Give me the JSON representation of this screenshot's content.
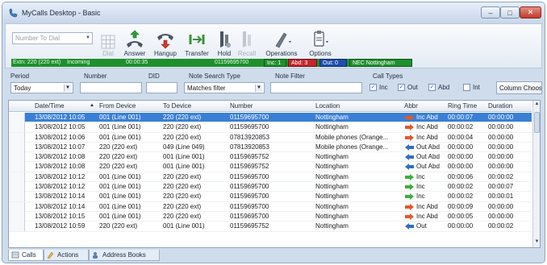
{
  "window": {
    "title": "MyCalls Desktop - Basic"
  },
  "toolbar": {
    "dial_placeholder": "Number To Dial",
    "buttons": {
      "dial": "Dial",
      "answer": "Answer",
      "hangup": "Hangup",
      "transfer": "Transfer",
      "hold": "Hold",
      "recall": "Recall",
      "operations": "Operations",
      "options": "Options"
    },
    "status": {
      "extn": "Extn: 220 (220 ext)",
      "state": "Incoming",
      "timer": "00:00:35",
      "number": "01159695700"
    },
    "counters": {
      "inc": "Inc: 1",
      "abd": "Abd: 3",
      "out": "Out: 0",
      "site": "NEC Nottingham"
    },
    "colors": {
      "green": "#1f8f2e",
      "red": "#c1272d",
      "blue": "#1f4fa8"
    }
  },
  "filters": {
    "period_label": "Period",
    "period_value": "Today",
    "number_label": "Number",
    "did_label": "DID",
    "note_search_type_label": "Note Search Type",
    "note_search_type_value": "Matches filter",
    "note_filter_label": "Note Filter",
    "call_types_label": "Call Types",
    "call_types": {
      "inc": "Inc",
      "out": "Out",
      "abd": "Abd",
      "int": "Int"
    },
    "column_chooser": "Column Chooser"
  },
  "grid": {
    "columns": [
      "Date/Time",
      "From Device",
      "To Device",
      "Number",
      "Location",
      "Abbr",
      "Ring Time",
      "Duration"
    ],
    "rows": [
      [
        "13/08/2012 10:05",
        "001 (Line 001)",
        "220 (220 ext)",
        "01159695700",
        "Nottingham",
        "Inc Abd",
        "00:00:07",
        "00:00:00"
      ],
      [
        "13/08/2012 10:05",
        "001 (Line 001)",
        "220 (220 ext)",
        "01159695700",
        "Nottingham",
        "Inc Abd",
        "00:00:02",
        "00:00:00"
      ],
      [
        "13/08/2012 10:06",
        "001 (Line 001)",
        "220 (220 ext)",
        "07813920853",
        "Mobile phones (Orange...",
        "Inc Abd",
        "00:00:04",
        "00:00:00"
      ],
      [
        "13/08/2012 10:07",
        "220 (220 ext)",
        "049 (Line 049)",
        "07813920853",
        "Mobile phones (Orange...",
        "Out Abd",
        "00:00:00",
        "00:00:00"
      ],
      [
        "13/08/2012 10:08",
        "220 (220 ext)",
        "001 (Line 001)",
        "01159695752",
        "Nottingham",
        "Out Abd",
        "00:00:00",
        "00:00:00"
      ],
      [
        "13/08/2012 10:08",
        "220 (220 ext)",
        "001 (Line 001)",
        "01159695752",
        "Nottingham",
        "Out Abd",
        "00:00:00",
        "00:00:00"
      ],
      [
        "13/08/2012 10:12",
        "001 (Line 001)",
        "220 (220 ext)",
        "01159695700",
        "Nottingham",
        "Inc",
        "00:00:06",
        "00:00:02"
      ],
      [
        "13/08/2012 10:12",
        "001 (Line 001)",
        "220 (220 ext)",
        "01159695700",
        "Nottingham",
        "Inc",
        "00:00:02",
        "00:00:07"
      ],
      [
        "13/08/2012 10:14",
        "001 (Line 001)",
        "220 (220 ext)",
        "01159695700",
        "Nottingham",
        "Inc",
        "00:00:02",
        "00:00:01"
      ],
      [
        "13/08/2012 10:14",
        "001 (Line 001)",
        "220 (220 ext)",
        "01159695700",
        "Nottingham",
        "Inc Abd",
        "00:00:09",
        "00:00:00"
      ],
      [
        "13/08/2012 10:15",
        "001 (Line 001)",
        "220 (220 ext)",
        "01159695700",
        "Nottingham",
        "Inc Abd",
        "00:00:05",
        "00:00:00"
      ],
      [
        "13/08/2012 10:59",
        "220 (220 ext)",
        "001 (Line 001)",
        "01159695752",
        "Nottingham",
        "Out",
        "00:00:00",
        "00:00:02"
      ]
    ],
    "selected_row": 0
  },
  "tabs": [
    "Calls",
    "Actions",
    "Address Books"
  ]
}
